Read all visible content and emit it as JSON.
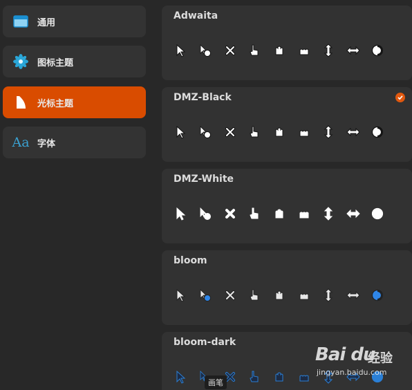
{
  "sidebar": {
    "items": [
      {
        "label": "通用",
        "icon": "window-icon",
        "active": false
      },
      {
        "label": "图标主题",
        "icon": "flower-icon",
        "active": false
      },
      {
        "label": "光标主题",
        "icon": "cursor-icon",
        "active": true
      },
      {
        "label": "字体",
        "icon": "font-icon",
        "active": false
      }
    ],
    "font_icon_text": "Aa"
  },
  "themes": [
    {
      "name": "Adwaita",
      "selected": false,
      "style": "white-outline"
    },
    {
      "name": "DMZ-Black",
      "selected": true,
      "style": "white-outline"
    },
    {
      "name": "DMZ-White",
      "selected": false,
      "style": "white-fill"
    },
    {
      "name": "bloom",
      "selected": false,
      "style": "blue"
    },
    {
      "name": "bloom-dark",
      "selected": false,
      "style": "dark-blue"
    }
  ],
  "cursor_icons": [
    "arrow-cursor-icon",
    "busy-cursor-icon",
    "crosshair-x-icon",
    "pointing-hand-icon",
    "open-hand-icon",
    "grab-hand-icon",
    "resize-vertical-icon",
    "resize-horizontal-icon",
    "wait-circle-icon"
  ],
  "tooltip": "画笔",
  "watermark": {
    "brand": "Bai du",
    "cn": "经验",
    "url": "jingyan.baidu.com"
  },
  "colors": {
    "accent": "#d94c00",
    "card": "#323232",
    "sidebar_item": "#333333",
    "background": "#282828"
  }
}
